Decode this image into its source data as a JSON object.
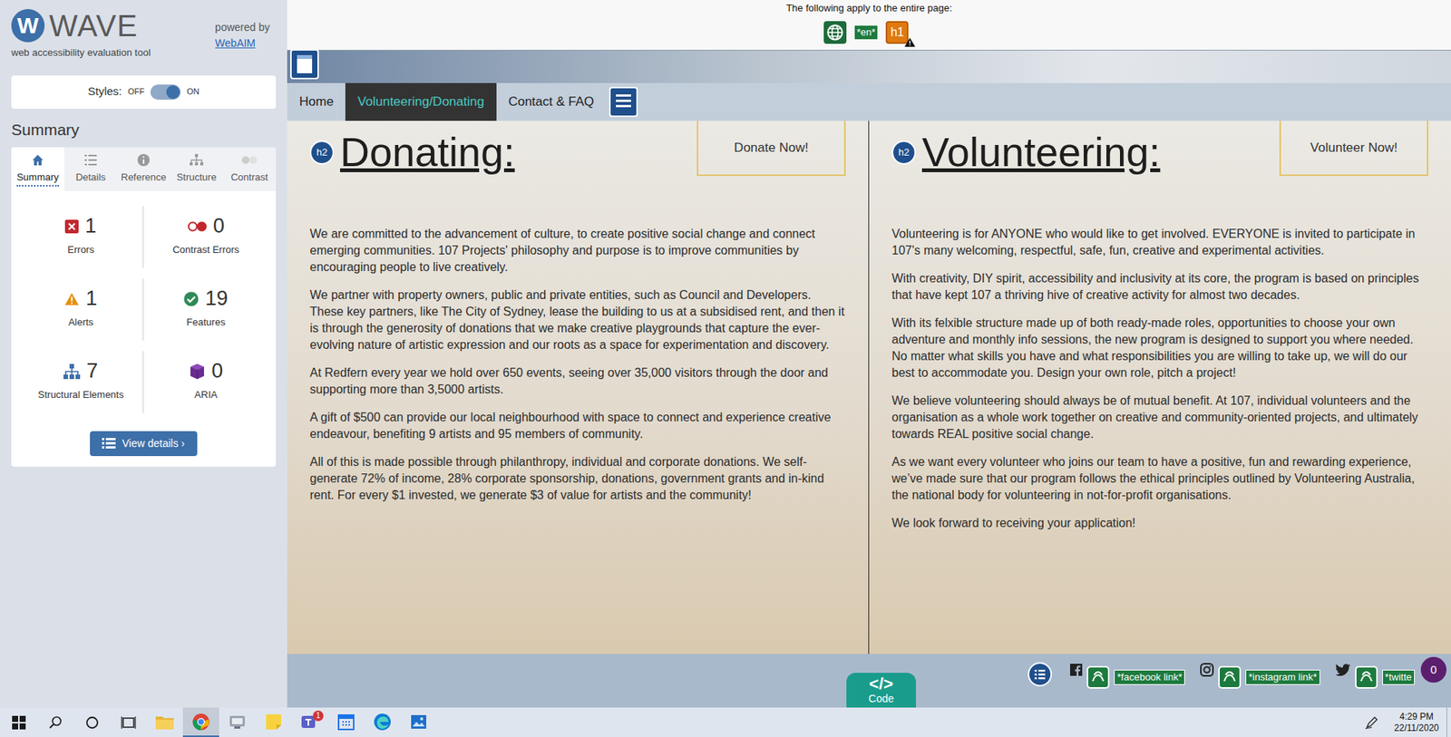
{
  "wave": {
    "logo_mark": "W",
    "logo": "WAVE",
    "tagline": "web accessibility evaluation tool",
    "powered_by": "powered by",
    "webaim": "WebAIM",
    "styles": {
      "label": "Styles:",
      "off": "OFF",
      "on": "ON",
      "on_state": true
    },
    "heading": "Summary",
    "tabs": [
      {
        "label": "Summary",
        "selected": true
      },
      {
        "label": "Details",
        "selected": false
      },
      {
        "label": "Reference",
        "selected": false
      },
      {
        "label": "Structure",
        "selected": false
      },
      {
        "label": "Contrast",
        "selected": false
      }
    ],
    "stats": [
      {
        "count": "1",
        "label": "Errors",
        "kind": "error"
      },
      {
        "count": "0",
        "label": "Contrast Errors",
        "kind": "contrast"
      },
      {
        "count": "1",
        "label": "Alerts",
        "kind": "alert"
      },
      {
        "count": "19",
        "label": "Features",
        "kind": "feature"
      },
      {
        "count": "7",
        "label": "Structural Elements",
        "kind": "structure"
      },
      {
        "count": "0",
        "label": "ARIA",
        "kind": "aria"
      }
    ],
    "button": "View details ›"
  },
  "page_icons": {
    "caption": "The following apply to the entire page:",
    "badges": [
      {
        "kind": "globe"
      },
      {
        "kind": "lang",
        "text": "*en*"
      },
      {
        "kind": "heading",
        "text": "h1"
      }
    ]
  },
  "site": {
    "nav": [
      {
        "label": "Home",
        "selected": false
      },
      {
        "label": "Volunteering/Donating",
        "selected": true
      },
      {
        "label": "Contact & FAQ",
        "selected": false
      }
    ],
    "columns": [
      {
        "badge": "h2",
        "heading": "Donating:",
        "button": "Donate Now!",
        "paragraphs": [
          "We are committed to the advancement of culture, to create positive social change and connect emerging communities. 107 Projects' philosophy and purpose is to improve communities by encouraging people to live creatively.",
          "We partner with property owners, public and private entities, such as Council and Developers. These key partners, like The City of Sydney, lease the building to us at a subsidised rent, and then it is through the generosity of donations that we make creative playgrounds that capture the ever-evolving nature of artistic expression and our roots as a space for experimentation and discovery.",
          "At Redfern every year we hold over 650 events, seeing over 35,000 visitors through the door and supporting more than 3,5000 artists.",
          "A gift of $500 can provide our local neighbourhood with space to connect and experience creative endeavour, benefiting 9 artists and 95 members of community.",
          "All of this is made possible through philanthropy, individual and corporate donations. We self-generate 72% of income, 28% corporate sponsorship, donations, government grants and in-kind rent. For every $1 invested, we generate $3 of value for artists and the community!"
        ]
      },
      {
        "badge": "h2",
        "heading": "Volunteering:",
        "button": "Volunteer Now!",
        "paragraphs": [
          "Volunteering is for ANYONE who would like to get involved. EVERYONE is invited to participate in 107's many welcoming, respectful, safe, fun, creative and experimental activities.",
          "With creativity, DIY spirit, accessibility and inclusivity at its core, the program is based on principles that have kept 107 a thriving hive of creative activity for almost two decades.",
          "With its felxible structure made up of both ready-made roles, opportunities to choose your own adventure and monthly info sessions, the new program is designed to support you where needed. No matter what skills you have and what responsibilities you are willing to take up, we will do our best to accommodate you. Design your own role, pitch a project!",
          "We believe volunteering should always be of mutual benefit. At 107, individual volunteers and the organisation as a whole work together on creative and community-oriented projects, and ultimately towards REAL positive social change.",
          "As we want every volunteer who joins our team to have a positive, fun and rewarding experience, we’ve made sure that our program follows the ethical principles outlined by Volunteering Australia, the national body for volunteering in not-for-profit organisations.",
          "We look forward to receiving your application!"
        ]
      }
    ]
  },
  "footer": {
    "code": {
      "icon": "</>",
      "label": "Code"
    },
    "social": [
      {
        "network": "facebook",
        "label": "*facebook link*"
      },
      {
        "network": "instagram",
        "label": "*instagram link*"
      },
      {
        "network": "twitter",
        "label": "*twitte"
      }
    ],
    "badge": "0"
  },
  "taskbar": {
    "apps": [
      {
        "kind": "explorer",
        "active": false
      },
      {
        "kind": "chrome",
        "active": true
      },
      {
        "kind": "app",
        "active": false
      },
      {
        "kind": "notes",
        "active": false
      },
      {
        "kind": "teams",
        "active": false,
        "badge": "1"
      },
      {
        "kind": "calendar",
        "active": false
      },
      {
        "kind": "edge",
        "active": false
      },
      {
        "kind": "photos",
        "active": false
      }
    ],
    "time": "4:29 PM",
    "date": "22/11/2020"
  }
}
